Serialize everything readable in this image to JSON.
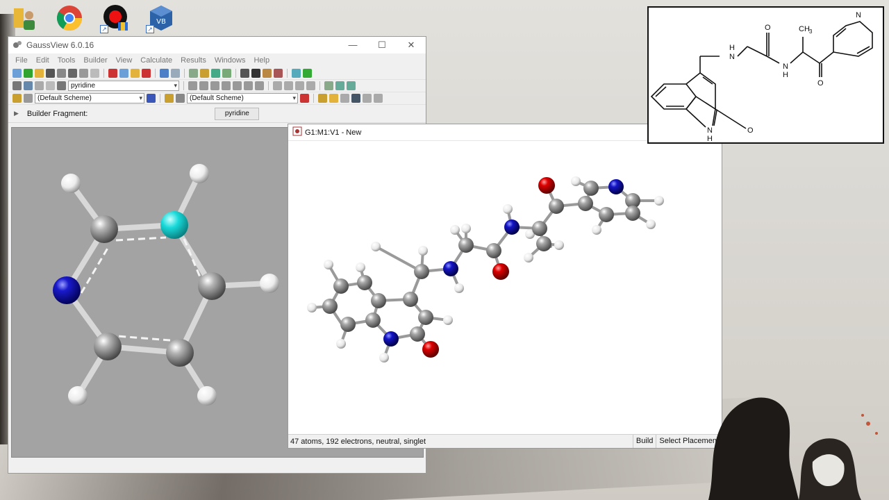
{
  "desktop": {
    "icons": [
      "user-file-icon",
      "chrome-icon",
      "recorder-icon",
      "virtualbox-icon"
    ]
  },
  "main_window": {
    "title": "GaussView 6.0.16",
    "menu": [
      "File",
      "Edit",
      "Tools",
      "Builder",
      "View",
      "Calculate",
      "Results",
      "Windows",
      "Help"
    ],
    "fragment_combo": "pyridine",
    "scheme_left": "(Default Scheme)",
    "scheme_right": "(Default Scheme)",
    "builder_fragment_label": "Builder Fragment:",
    "builder_fragment_value": "pyridine"
  },
  "molecule_window": {
    "title": "G1:M1:V1 - New",
    "status": "47 atoms, 192 electrons, neutral, singlet",
    "mode": "Build",
    "action": "Select Placement"
  },
  "structure_image": {
    "labels": {
      "n_amine": "H",
      "n_amine2": "N",
      "o_top": "O",
      "me": "CH",
      "me_sub": "3",
      "nh_top": "N",
      "nh_h": "H",
      "o_ketone": "O",
      "n_pyr": "N",
      "o_lactam": "O",
      "n_lactam": "N",
      "n_lactam_h": "H"
    }
  },
  "colors": {
    "carbon": "#8a8a8a",
    "nitrogen": "#1a1acc",
    "oxygen": "#dd0000",
    "hydrogen": "#ffffff",
    "selected": "#19d9d9",
    "builder_bg": "#a3a3a3"
  }
}
